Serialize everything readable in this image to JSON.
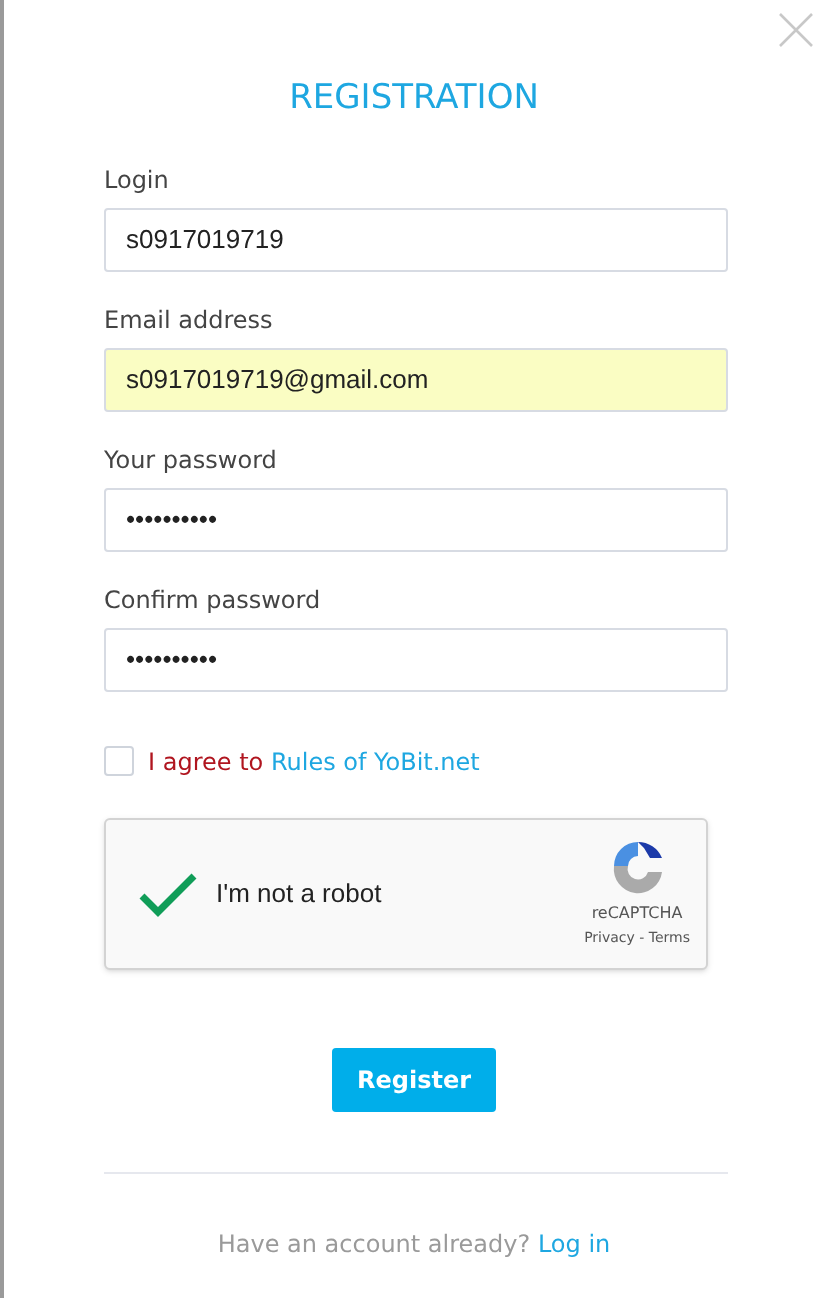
{
  "title": "REGISTRATION",
  "fields": [
    {
      "label": "Login",
      "value": "s0917019719",
      "autofilled": false
    },
    {
      "label": "Email address",
      "value": "s0917019719@gmail.com",
      "autofilled": true
    },
    {
      "label": "Your password",
      "value": "••••••••••",
      "autofilled": false
    },
    {
      "label": "Confirm password",
      "value": "••••••••••",
      "autofilled": false
    }
  ],
  "agree": {
    "checked": false,
    "text": "I agree to",
    "link": "Rules of YoBit.net"
  },
  "captcha": {
    "checked": true,
    "label": "I'm not a robot",
    "brand": "reCAPTCHA",
    "links": "Privacy - Terms"
  },
  "register_button": "Register",
  "footer": {
    "text": "Have an account already?",
    "link": "Log in"
  }
}
